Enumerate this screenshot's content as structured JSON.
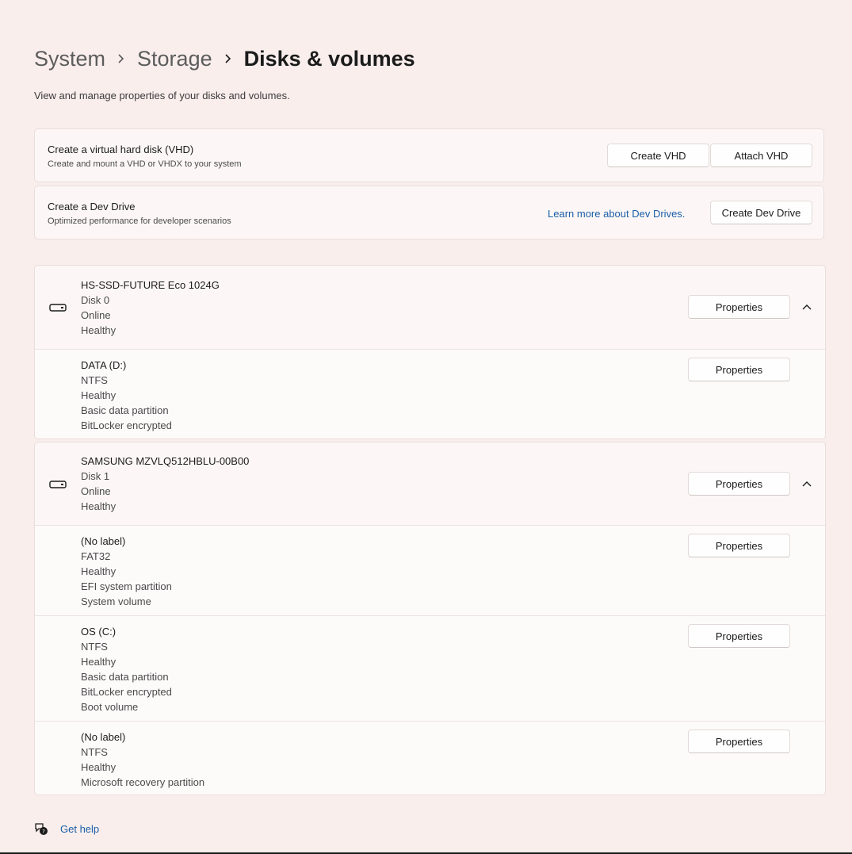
{
  "breadcrumb": {
    "items": [
      "System",
      "Storage",
      "Disks & volumes"
    ]
  },
  "subtitle": "View and manage properties of your disks and volumes.",
  "vhd_card": {
    "title": "Create a virtual hard disk (VHD)",
    "description": "Create and mount a VHD or VHDX to your system",
    "create_button": "Create VHD",
    "attach_button": "Attach VHD"
  },
  "dev_drive_card": {
    "title": "Create a Dev Drive",
    "description": "Optimized performance for developer scenarios",
    "learn_more_link": "Learn more about Dev Drives.",
    "create_button": "Create Dev Drive"
  },
  "disks": [
    {
      "name": "HS-SSD-FUTURE Eco 1024G",
      "details": [
        "Disk 0",
        "Online",
        "Healthy"
      ],
      "properties_label": "Properties",
      "volumes": [
        {
          "name": "DATA (D:)",
          "details": [
            "NTFS",
            "Healthy",
            "Basic data partition",
            "BitLocker encrypted"
          ],
          "properties_label": "Properties"
        }
      ]
    },
    {
      "name": "SAMSUNG MZVLQ512HBLU-00B00",
      "details": [
        "Disk 1",
        "Online",
        "Healthy"
      ],
      "properties_label": "Properties",
      "volumes": [
        {
          "name": "(No label)",
          "details": [
            "FAT32",
            "Healthy",
            "EFI system partition",
            "System volume"
          ],
          "properties_label": "Properties"
        },
        {
          "name": "OS (C:)",
          "details": [
            "NTFS",
            "Healthy",
            "Basic data partition",
            "BitLocker encrypted",
            "Boot volume"
          ],
          "properties_label": "Properties"
        },
        {
          "name": "(No label)",
          "details": [
            "NTFS",
            "Healthy",
            "Microsoft recovery partition"
          ],
          "properties_label": "Properties"
        }
      ]
    }
  ],
  "help": {
    "label": "Get help",
    "icon": "help-chat-icon"
  },
  "colors": {
    "background": "#f9eeec",
    "card": "#fcf7f6",
    "link": "#1a5fa8",
    "text": "#1b1b1b"
  }
}
